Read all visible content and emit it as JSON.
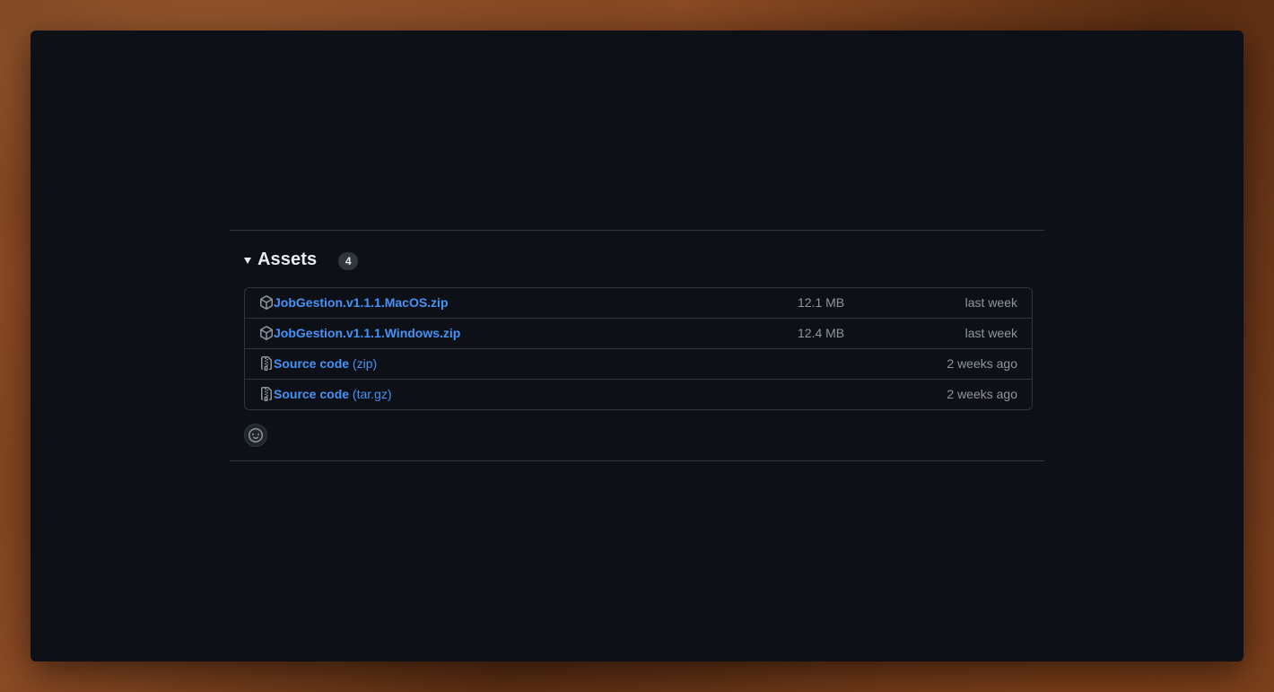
{
  "assets": {
    "title": "Assets",
    "count": "4",
    "items": [
      {
        "name": "JobGestion.v1.1.1.MacOS.zip",
        "suffix": "",
        "size": "12.1 MB",
        "date": "last week",
        "icon": "package-icon"
      },
      {
        "name": "JobGestion.v1.1.1.Windows.zip",
        "suffix": "",
        "size": "12.4 MB",
        "date": "last week",
        "icon": "package-icon"
      },
      {
        "name": "Source code",
        "suffix": "(zip)",
        "size": "",
        "date": "2 weeks ago",
        "icon": "file-zip-icon"
      },
      {
        "name": "Source code",
        "suffix": "(tar.gz)",
        "size": "",
        "date": "2 weeks ago",
        "icon": "file-zip-icon"
      }
    ]
  },
  "reaction": {
    "icon": "smiley-icon"
  },
  "colors": {
    "background": "#0d1117",
    "border": "#30363d",
    "link": "#4493f8",
    "muted": "#8d96a0",
    "text": "#e6edf3"
  }
}
